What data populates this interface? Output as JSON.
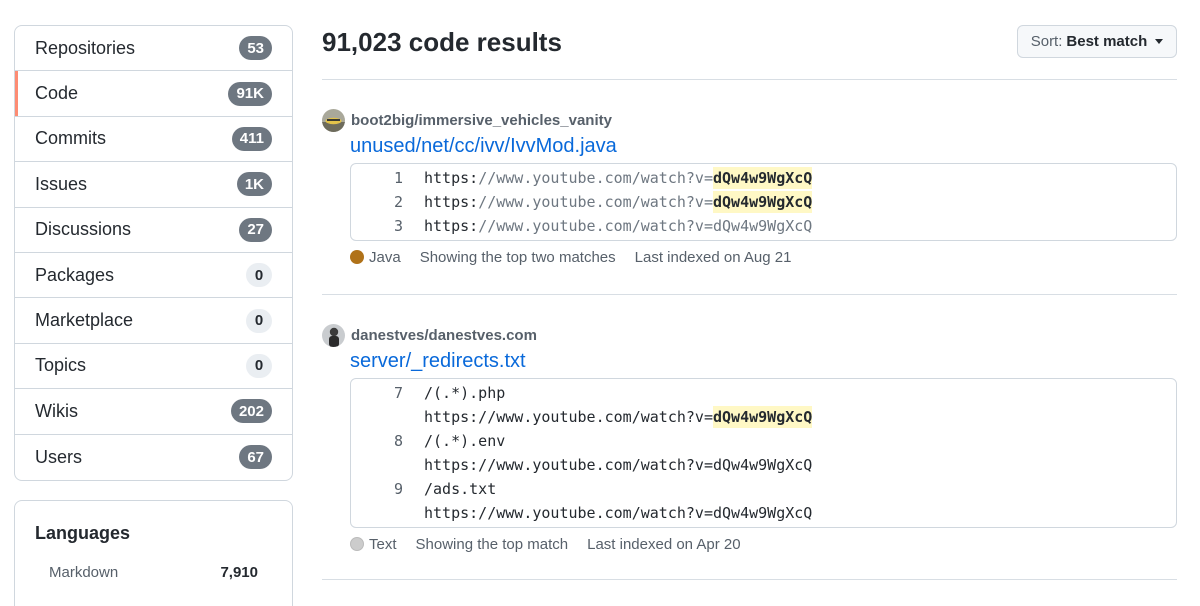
{
  "sidebar": {
    "items": [
      {
        "label": "Repositories",
        "count": "53",
        "style": "dark"
      },
      {
        "label": "Code",
        "count": "91K",
        "style": "dark",
        "selected": true
      },
      {
        "label": "Commits",
        "count": "411",
        "style": "dark"
      },
      {
        "label": "Issues",
        "count": "1K",
        "style": "dark"
      },
      {
        "label": "Discussions",
        "count": "27",
        "style": "dark"
      },
      {
        "label": "Packages",
        "count": "0",
        "style": "light"
      },
      {
        "label": "Marketplace",
        "count": "0",
        "style": "light"
      },
      {
        "label": "Topics",
        "count": "0",
        "style": "light"
      },
      {
        "label": "Wikis",
        "count": "202",
        "style": "dark"
      },
      {
        "label": "Users",
        "count": "67",
        "style": "dark"
      }
    ],
    "selected_accent": "#fd8c73"
  },
  "languages": {
    "title": "Languages",
    "items": [
      {
        "name": "Markdown",
        "count": "7,910"
      }
    ]
  },
  "header": {
    "title": "91,023 code results",
    "sort_label": "Sort:",
    "sort_value": "Best match"
  },
  "results": [
    {
      "repo": "boot2big/immersive_vehicles_vanity",
      "file": "unused/net/cc/ivv/IvvMod.java",
      "lines": [
        {
          "ln": "1",
          "prefix": "https:",
          "rest": "//www.youtube.com/watch?v=",
          "match": "dQw4w9WgXcQ"
        },
        {
          "ln": "2",
          "prefix": "https:",
          "rest": "//www.youtube.com/watch?v=",
          "match": "dQw4w9WgXcQ"
        },
        {
          "ln": "3",
          "prefix": "https:",
          "rest": "//www.youtube.com/watch?v=dQw4w9WgXcQ",
          "match": ""
        }
      ],
      "language": "Java",
      "language_color": "#b07219",
      "matches_text": "Showing the top two matches",
      "indexed_text": "Last indexed on Aug 21"
    },
    {
      "repo": "danestves/danestves.com",
      "file": "server/_redirects.txt",
      "lines": [
        {
          "ln": "7",
          "text": "/(.*).php"
        },
        {
          "ln": "",
          "text": "https://www.youtube.com/watch?v=",
          "match": "dQw4w9WgXcQ"
        },
        {
          "ln": "8",
          "text": "/(.*).env"
        },
        {
          "ln": "",
          "text": "https://www.youtube.com/watch?v=dQw4w9WgXcQ"
        },
        {
          "ln": "9",
          "text": "/ads.txt"
        },
        {
          "ln": "",
          "text": "https://www.youtube.com/watch?v=dQw4w9WgXcQ"
        }
      ],
      "language": "Text",
      "language_color": "#cccccc",
      "matches_text": "Showing the top match",
      "indexed_text": "Last indexed on Apr 20"
    }
  ]
}
